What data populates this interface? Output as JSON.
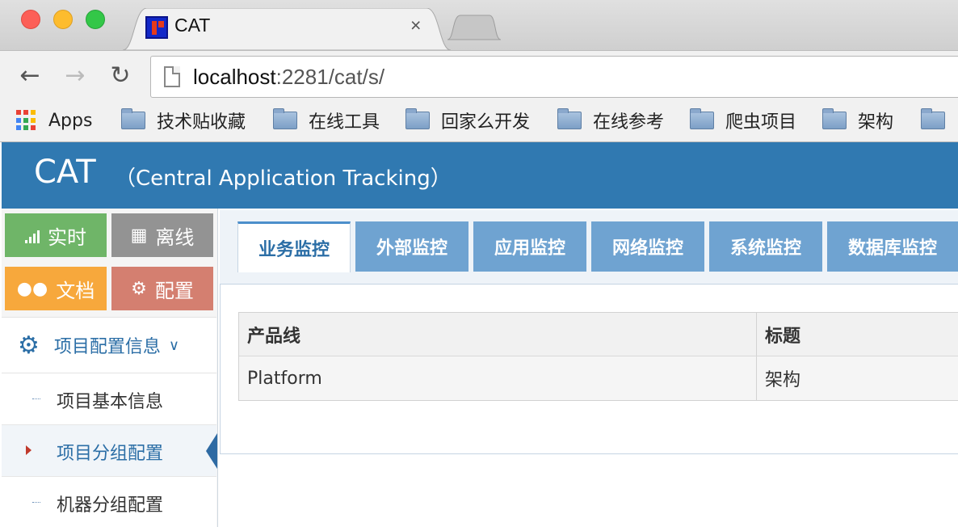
{
  "browser": {
    "tab_title": "CAT",
    "tab_close": "×",
    "url_host": "localhost",
    "url_rest": ":2281/cat/s/",
    "bookmarks": [
      {
        "label": "Apps",
        "icon": "apps-grid-icon"
      },
      {
        "label": "技术贴收藏",
        "icon": "folder-icon"
      },
      {
        "label": "在线工具",
        "icon": "folder-icon"
      },
      {
        "label": "回家么开发",
        "icon": "folder-icon"
      },
      {
        "label": "在线参考",
        "icon": "folder-icon"
      },
      {
        "label": "爬虫项目",
        "icon": "folder-icon"
      },
      {
        "label": "架构",
        "icon": "folder-icon"
      }
    ]
  },
  "header": {
    "brand": "CAT",
    "subtitle": "（Central Application Tracking）",
    "color": "#3079b1"
  },
  "sidebar": {
    "shortcuts": [
      {
        "label": "实时",
        "icon": "signal-bars-icon",
        "color": "#6fb568"
      },
      {
        "label": "离线",
        "icon": "film-icon",
        "color": "#939393"
      },
      {
        "label": "文档",
        "icon": "users-icon",
        "color": "#f7a83c"
      },
      {
        "label": "配置",
        "icon": "gears-icon",
        "color": "#d47f70"
      }
    ],
    "menu_parent": "项目配置信息",
    "menu_items": [
      "项目基本信息",
      "项目分组配置",
      "机器分组配置"
    ],
    "active_item": "项目分组配置"
  },
  "content": {
    "tabs": [
      "业务监控",
      "外部监控",
      "应用监控",
      "网络监控",
      "系统监控",
      "数据库监控"
    ],
    "active_tab": "业务监控",
    "table": {
      "headers": [
        "产品线",
        "标题"
      ],
      "rows": [
        [
          "Platform",
          "架构"
        ]
      ]
    }
  }
}
